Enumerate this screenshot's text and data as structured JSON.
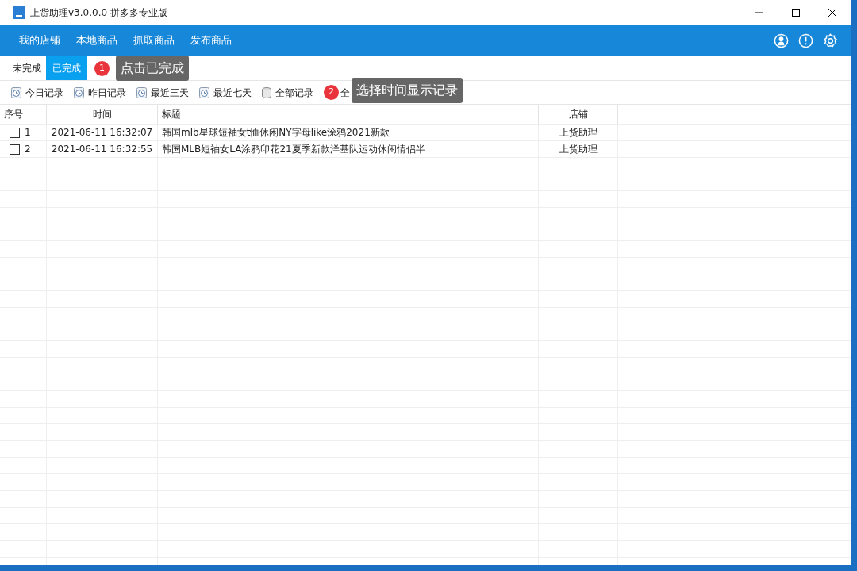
{
  "window": {
    "title": "上货助理v3.0.0.0 拼多多专业版"
  },
  "nav": [
    "我的店铺",
    "本地商品",
    "抓取商品",
    "发布商品"
  ],
  "tabs": [
    {
      "label": "未完成",
      "selected": false
    },
    {
      "label": "已完成",
      "selected": true
    }
  ],
  "tab_hint": {
    "number": "1",
    "text": "点击已完成"
  },
  "filters": [
    {
      "label": "今日记录",
      "kind": "clock"
    },
    {
      "label": "昨日记录",
      "kind": "clock"
    },
    {
      "label": "最近三天",
      "kind": "clock"
    },
    {
      "label": "最近七天",
      "kind": "clock"
    },
    {
      "label": "全部记录",
      "kind": "database"
    },
    {
      "label": "全",
      "kind": "text"
    }
  ],
  "filter_hint": {
    "number": "2",
    "text": "选择时间显示记录"
  },
  "table": {
    "columns": [
      "序号",
      "时间",
      "标题",
      "店铺"
    ],
    "rows": [
      {
        "index": "1",
        "checked": false,
        "time": "2021-06-11 16:32:07",
        "title": "韩国mlb星球短袖女t恤休闲NY字母like涂鸦2021新款",
        "shop": "上货助理"
      },
      {
        "index": "2",
        "checked": false,
        "time": "2021-06-11 16:32:55",
        "title": "韩国MLB短袖女LA涂鸦印花21夏季新款洋基队运动休闲情侣半",
        "shop": "上货助理"
      }
    ]
  }
}
